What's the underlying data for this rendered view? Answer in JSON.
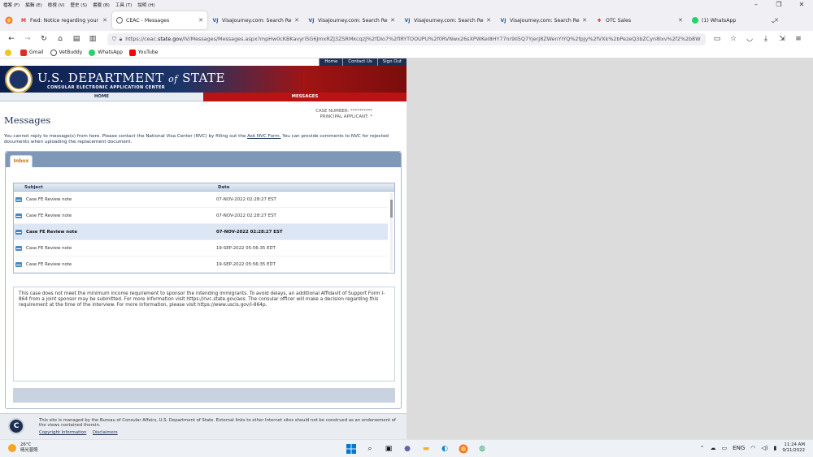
{
  "menubar": {
    "items": [
      "檔案 (F)",
      "編輯 (E)",
      "檢視 (V)",
      "歷史 (S)",
      "書籤 (B)",
      "工具 (T)",
      "說明 (H)"
    ]
  },
  "tabs": [
    {
      "title": "Fwd: Notice regarding your In",
      "icon": "gmail",
      "active": false
    },
    {
      "title": "CEAC - Messages",
      "icon": "globe",
      "active": true
    },
    {
      "title": "VisaJourney.com: Search Resu",
      "icon": "visajourney",
      "active": false
    },
    {
      "title": "VisaJourney.com: Search Resu",
      "icon": "visajourney",
      "active": false
    },
    {
      "title": "VisaJourney.com: Search Resu",
      "icon": "visajourney",
      "active": false
    },
    {
      "title": "VisaJourney.com: Search Resu",
      "icon": "visajourney",
      "active": false
    },
    {
      "title": "OTC Sales",
      "icon": "otc",
      "active": false
    },
    {
      "title": "(1) WhatsApp",
      "icon": "whatsapp",
      "active": false
    }
  ],
  "url": {
    "prefix": "https://ceac.",
    "domain": "state.gov",
    "rest": "/IV/Messages/Messages.aspx?mpHw0cKBKavyrl5G6JmxRZJ3ZSRMkcqzJ%2fDlo7%2flRYTOOUPU%2f0RVNwx26sXPWKel8HY77nr9Ii5Q7YjerJ8ZWenYIYQ%2fpJy%2fVXk%2bPezeQ3bZCyn8lxv%2f2%2b8W"
  },
  "bookmarks": [
    {
      "label": "Gmail",
      "color": "#d93025"
    },
    {
      "label": "VetBuddy",
      "color": "#555555"
    },
    {
      "label": "WhatsApp",
      "color": "#25d366"
    },
    {
      "label": "YouTube",
      "color": "#ff0000"
    }
  ],
  "site": {
    "topnav": [
      "Home",
      "Contact Us",
      "Sign Out"
    ],
    "dept_title": "U.S. DEPARTMENT",
    "dept_of": "of",
    "dept_state": "STATE",
    "subtitle": "CONSULAR ELECTRONIC APPLICATION CENTER",
    "menu_home": "HOME",
    "menu_messages": "MESSAGES",
    "case_number_label": "CASE NUMBER:",
    "case_number_value": "**********",
    "principal_label": "PRINCIPAL APPLICANT:",
    "principal_value": "*",
    "page_title": "Messages",
    "notice_pre": "You cannot reply to message(s) from here.  Please contact the National Visa Center (NVC) by filling out the ",
    "notice_link": "Ask NVC Form.",
    "notice_post": "  You can provide comments to NVC for rejected documents when uploading the replacement document.",
    "inbox_tab": "Inbox",
    "grid_headers": {
      "subject": "Subject",
      "date": "Date"
    },
    "messages": [
      {
        "subject": "Case FE Review note",
        "date": "07-NOV-2022 02:28:27 EST",
        "selected": false
      },
      {
        "subject": "Case FE Review note",
        "date": "07-NOV-2022 02:28:27 EST",
        "selected": false
      },
      {
        "subject": "Case FE Review note",
        "date": "07-NOV-2022 02:28:27 EST",
        "selected": true
      },
      {
        "subject": "Case FE Review note",
        "date": "19-SEP-2022 05:56:35 EDT",
        "selected": false
      },
      {
        "subject": "Case FE Review note",
        "date": "19-SEP-2022 05:56:35 EDT",
        "selected": false
      }
    ],
    "message_body": "This case does not meet the minimum income requirement to sponsor the intending immigrants. To avoid delays, an additional Affidavit of Support Form I-864 from a joint sponsor may be submitted. For more information visit https://nvc.state.gov/aos. The consular officer will make a decision regarding this requirement at the time of the interview. For more information, please visit https://www.uscis.gov/i-864p.",
    "footer_text": "This site is managed by the Bureau of Consular Affairs, U.S. Department of State. External links to other Internet sites should not be construed as an endorsement of the views contained therein.",
    "footer_links": [
      "Copyright Information",
      "Disclaimers"
    ],
    "footer_logo_letter": "C"
  },
  "taskbar": {
    "temp": "26°C",
    "weather": "晴光普照",
    "lang": "ENG",
    "time": "11:24 AM",
    "date": "9/11/2022"
  },
  "colors": {
    "navy": "#1e2f52",
    "red": "#b81414",
    "inbox_orange": "#c47a10"
  }
}
